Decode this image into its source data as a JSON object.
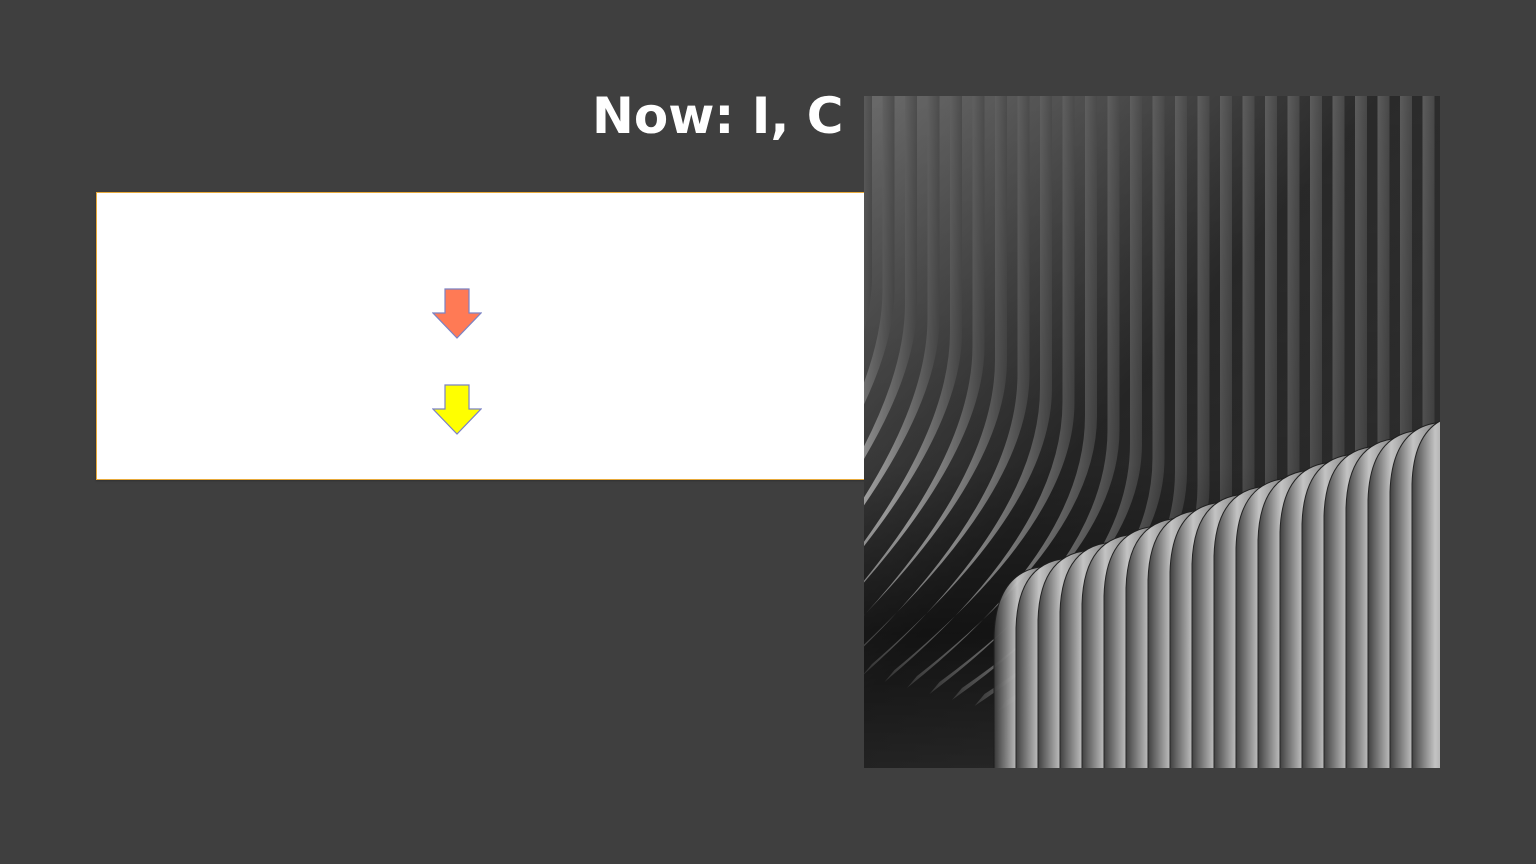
{
  "slide": {
    "title": "Now: I, C",
    "background": "#3f3f3f",
    "box_border_color": "#e7a93a"
  },
  "arrows": [
    {
      "icon": "down-arrow-icon",
      "color": "#ff7a55"
    },
    {
      "icon": "down-arrow-icon",
      "color": "#ffff00"
    }
  ],
  "image": {
    "subject": "black-and-white-curved-architecture-photo"
  }
}
